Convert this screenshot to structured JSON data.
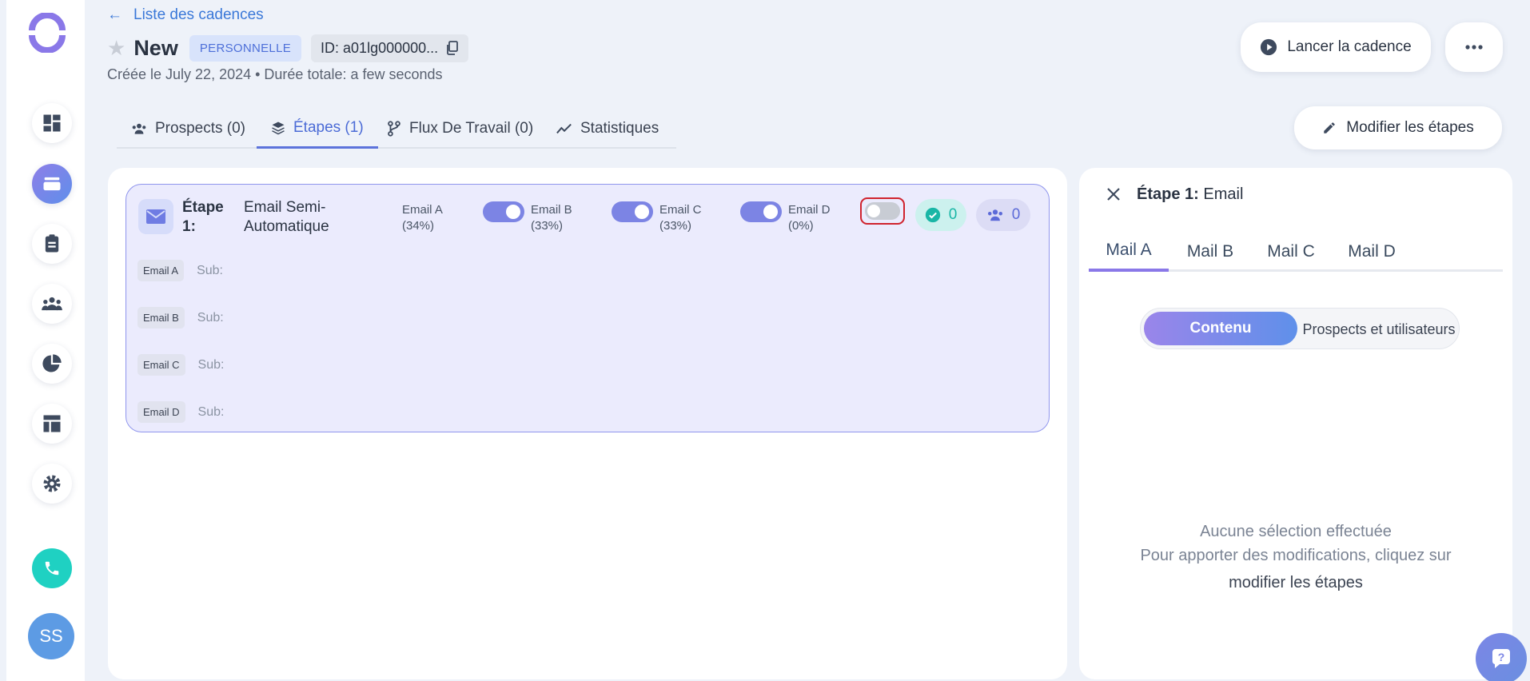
{
  "header": {
    "back_link": "Liste des cadences",
    "title": "New",
    "badge": "PERSONNELLE",
    "id_label": "ID: a01lg000000...",
    "created": "Créée le July 22, 2024 • Durée totale: a few seconds",
    "launch_button": "Lancer la cadence",
    "edit_steps_button": "Modifier les étapes"
  },
  "sidebar": {
    "avatar_initials": "SS"
  },
  "tabs": [
    {
      "label": "Prospects (0)",
      "icon": "users-icon"
    },
    {
      "label": "Étapes (1)",
      "icon": "layers-icon",
      "active": true
    },
    {
      "label": "Flux De Travail (0)",
      "icon": "workflow-icon"
    },
    {
      "label": "Statistiques",
      "icon": "chart-line-icon"
    }
  ],
  "step": {
    "label": "Étape 1:",
    "type": "Email Semi-Automatique",
    "variants": [
      {
        "name": "Email A",
        "pct": "(34%)"
      },
      {
        "name": "Email B",
        "pct": "(33%)",
        "enabled": true
      },
      {
        "name": "Email C",
        "pct": "(33%)",
        "enabled": true
      },
      {
        "name": "Email D",
        "pct": "(0%)",
        "enabled": true
      }
    ],
    "step_enabled": false,
    "completed_count": "0",
    "people_count": "0",
    "emails": [
      {
        "chip": "Email A",
        "sub": "Sub:"
      },
      {
        "chip": "Email B",
        "sub": "Sub:"
      },
      {
        "chip": "Email C",
        "sub": "Sub:"
      },
      {
        "chip": "Email D",
        "sub": "Sub:"
      }
    ]
  },
  "right_panel": {
    "title_bold": "Étape 1:",
    "title_rest": "Email",
    "mail_tabs": [
      "Mail A",
      "Mail B",
      "Mail C",
      "Mail D"
    ],
    "segment_active": "Contenu",
    "segment_inactive": "Prospects et utilisateurs",
    "empty_line1": "Aucune sélection effectuée",
    "empty_line2": "Pour apporter des modifications, cliquez sur",
    "empty_link": "modifier les étapes"
  },
  "colors": {
    "accent": "#5c73db",
    "teal": "#1fd1c2",
    "card_bg": "#ebebfd"
  }
}
